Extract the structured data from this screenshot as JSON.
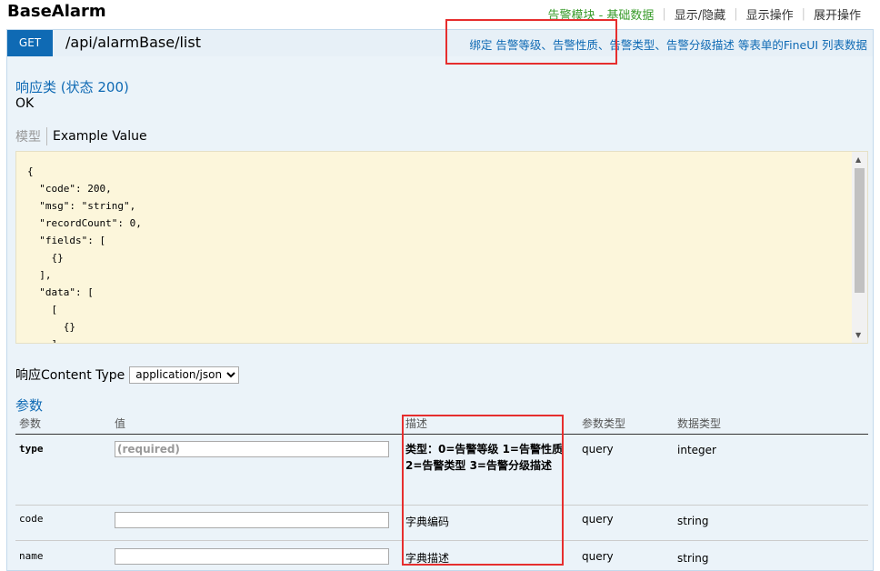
{
  "header": {
    "title": "BaseAlarm",
    "links": [
      "告警模块 - 基础数据",
      "显示/隐藏",
      "显示操作",
      "展开操作"
    ]
  },
  "operation": {
    "method": "GET",
    "path": "/api/alarmBase/list",
    "summary": "绑定 告警等级、告警性质、告警类型、告警分级描述 等表单的FineUI 列表数据"
  },
  "response": {
    "title": "响应类 (状态 200)",
    "status_text": "OK",
    "tab_model": "模型",
    "tab_example": "Example Value",
    "example_code": "{\n  \"code\": 200,\n  \"msg\": \"string\",\n  \"recordCount\": 0,\n  \"fields\": [\n    {}\n  ],\n  \"data\": [\n    [\n      {}\n    ]",
    "content_type_label": "响应Content Type",
    "content_type_value": "application/json"
  },
  "params": {
    "title": "参数",
    "headers": {
      "name": "参数",
      "value": "值",
      "desc": "描述",
      "ptype": "参数类型",
      "dtype": "数据类型"
    },
    "rows": [
      {
        "name": "type",
        "placeholder": "(required)",
        "desc": "类型：0=告警等级 1=告警性质 2=告警类型 3=告警分级描述",
        "ptype": "query",
        "dtype": "integer"
      },
      {
        "name": "code",
        "placeholder": "",
        "desc": "字典编码",
        "ptype": "query",
        "dtype": "string"
      },
      {
        "name": "name",
        "placeholder": "",
        "desc": "字典描述",
        "ptype": "query",
        "dtype": "string"
      }
    ]
  },
  "colors": {
    "accent": "#0f6ab4",
    "annotation": "#e62e2e",
    "link_green": "#3a9c2c"
  }
}
